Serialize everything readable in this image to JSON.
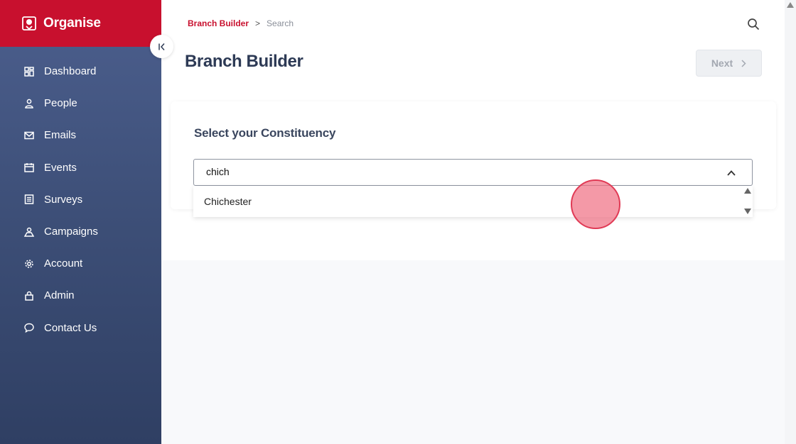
{
  "brand": {
    "name": "Organise",
    "color": "#c8102e"
  },
  "sidebar": {
    "items": [
      {
        "label": "Dashboard",
        "icon": "dashboard-icon"
      },
      {
        "label": "People",
        "icon": "person-icon"
      },
      {
        "label": "Emails",
        "icon": "mail-icon"
      },
      {
        "label": "Events",
        "icon": "calendar-icon"
      },
      {
        "label": "Surveys",
        "icon": "survey-icon"
      },
      {
        "label": "Campaigns",
        "icon": "campaign-icon"
      },
      {
        "label": "Account",
        "icon": "gear-icon"
      },
      {
        "label": "Admin",
        "icon": "lock-icon"
      },
      {
        "label": "Contact Us",
        "icon": "chat-icon"
      }
    ]
  },
  "breadcrumb": {
    "link": "Branch Builder",
    "separator": ">",
    "current": "Search"
  },
  "header": {
    "title": "Branch Builder",
    "next_label": "Next",
    "next_icon": "chevron-right-icon"
  },
  "card": {
    "title": "Select your Constituency"
  },
  "select": {
    "value": "chich",
    "options": [
      "Chichester"
    ]
  }
}
